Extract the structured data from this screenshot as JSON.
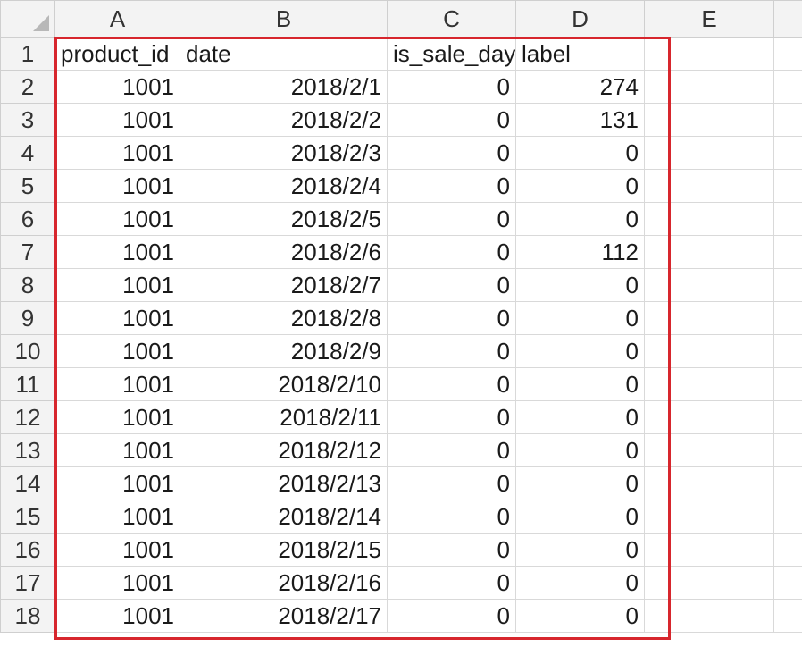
{
  "columns": [
    "A",
    "B",
    "C",
    "D",
    "E"
  ],
  "header_row": {
    "row_number": "1",
    "cells": [
      "product_id",
      "date",
      "is_sale_day",
      "label"
    ]
  },
  "rows": [
    {
      "n": "2",
      "product_id": "1001",
      "date": "2018/2/1",
      "is_sale_day": "0",
      "label": "274"
    },
    {
      "n": "3",
      "product_id": "1001",
      "date": "2018/2/2",
      "is_sale_day": "0",
      "label": "131"
    },
    {
      "n": "4",
      "product_id": "1001",
      "date": "2018/2/3",
      "is_sale_day": "0",
      "label": "0"
    },
    {
      "n": "5",
      "product_id": "1001",
      "date": "2018/2/4",
      "is_sale_day": "0",
      "label": "0"
    },
    {
      "n": "6",
      "product_id": "1001",
      "date": "2018/2/5",
      "is_sale_day": "0",
      "label": "0"
    },
    {
      "n": "7",
      "product_id": "1001",
      "date": "2018/2/6",
      "is_sale_day": "0",
      "label": "112"
    },
    {
      "n": "8",
      "product_id": "1001",
      "date": "2018/2/7",
      "is_sale_day": "0",
      "label": "0"
    },
    {
      "n": "9",
      "product_id": "1001",
      "date": "2018/2/8",
      "is_sale_day": "0",
      "label": "0"
    },
    {
      "n": "10",
      "product_id": "1001",
      "date": "2018/2/9",
      "is_sale_day": "0",
      "label": "0"
    },
    {
      "n": "11",
      "product_id": "1001",
      "date": "2018/2/10",
      "is_sale_day": "0",
      "label": "0"
    },
    {
      "n": "12",
      "product_id": "1001",
      "date": "2018/2/11",
      "is_sale_day": "0",
      "label": "0"
    },
    {
      "n": "13",
      "product_id": "1001",
      "date": "2018/2/12",
      "is_sale_day": "0",
      "label": "0"
    },
    {
      "n": "14",
      "product_id": "1001",
      "date": "2018/2/13",
      "is_sale_day": "0",
      "label": "0"
    },
    {
      "n": "15",
      "product_id": "1001",
      "date": "2018/2/14",
      "is_sale_day": "0",
      "label": "0"
    },
    {
      "n": "16",
      "product_id": "1001",
      "date": "2018/2/15",
      "is_sale_day": "0",
      "label": "0"
    },
    {
      "n": "17",
      "product_id": "1001",
      "date": "2018/2/16",
      "is_sale_day": "0",
      "label": "0"
    },
    {
      "n": "18",
      "product_id": "1001",
      "date": "2018/2/17",
      "is_sale_day": "0",
      "label": "0"
    }
  ],
  "selection_color": "#d7262d",
  "icons": {
    "select_all": "select-all-triangle-icon"
  }
}
